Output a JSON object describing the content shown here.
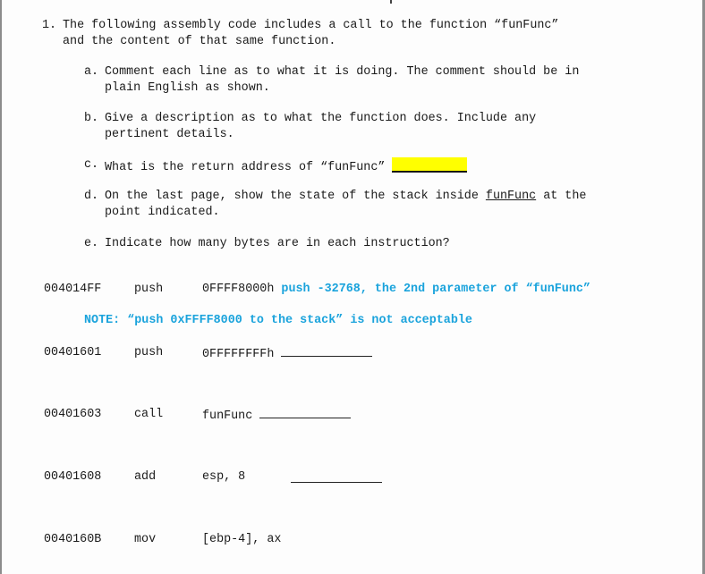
{
  "question": {
    "number": "1.",
    "intro_line1": "The following assembly code includes a call to the function “funFunc”",
    "intro_line2": "and the content of that same function.",
    "parts": [
      {
        "letter": "a.",
        "line1": "Comment each line as to what it is doing. The comment should be in",
        "line2": "plain English as shown."
      },
      {
        "letter": "b.",
        "line1": "Give a description as to what the function does. Include any",
        "line2": "pertinent details."
      },
      {
        "letter": "c.",
        "line1": "What is the return address of “funFunc”"
      },
      {
        "letter": "d.",
        "line1_pre": "On the last page, show the state of the stack inside ",
        "line1_link": "funFunc",
        "line1_post": " at the",
        "line2": "point indicated."
      },
      {
        "letter": "e.",
        "line1": "Indicate how many bytes are in each instruction?"
      }
    ]
  },
  "code": [
    {
      "address": "004014FF",
      "mnemonic": "push",
      "operand": "0FFFF8000h",
      "comment": "push -32768, the 2nd parameter of “funFunc”"
    },
    {
      "address": "00401601",
      "mnemonic": "push",
      "operand": "0FFFFFFFFh",
      "comment": ""
    },
    {
      "address": "00401603",
      "mnemonic": "call",
      "operand": "funFunc",
      "comment": ""
    },
    {
      "address": "00401608",
      "mnemonic": "add",
      "operand": "esp, 8",
      "comment": ""
    },
    {
      "address": "0040160B",
      "mnemonic": "mov",
      "operand": "[ebp-4], ax",
      "comment": ""
    }
  ],
  "note": "NOTE: “push 0xFFFF8000 to the stack” is not acceptable",
  "colors": {
    "comment_blue": "#1aa3dc",
    "highlight": "#ffff00"
  }
}
